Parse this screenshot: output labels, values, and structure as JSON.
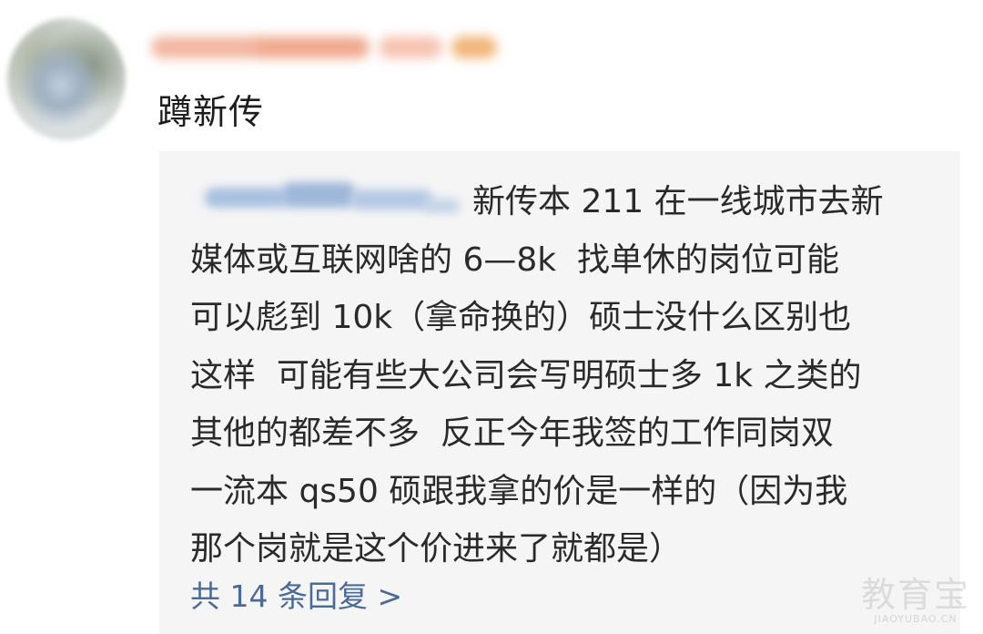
{
  "comment": {
    "text": "蹲新传"
  },
  "quote": {
    "lines": [
      "新传本 211 在一线城市去新",
      "媒体或互联网啥的 6—8k  找单休的岗位可能",
      "可以彪到 10k（拿命换的）硕士没什么区别也",
      "这样  可能有些大公司会写明硕士多 1k 之类的",
      "其他的都差不多  反正今年我签的工作同岗双",
      "一流本 qs50 硕跟我拿的价是一样的（因为我",
      "那个岗就是这个价进来了就都是）"
    ],
    "reply_link": "共 14 条回复 >"
  },
  "watermark": {
    "main": "教育宝",
    "sub": "JIAOYUBAO.CN"
  },
  "colors": {
    "text": "#1d1d1d",
    "quote_bg": "#f5f5f6",
    "link": "#4c6a96"
  }
}
